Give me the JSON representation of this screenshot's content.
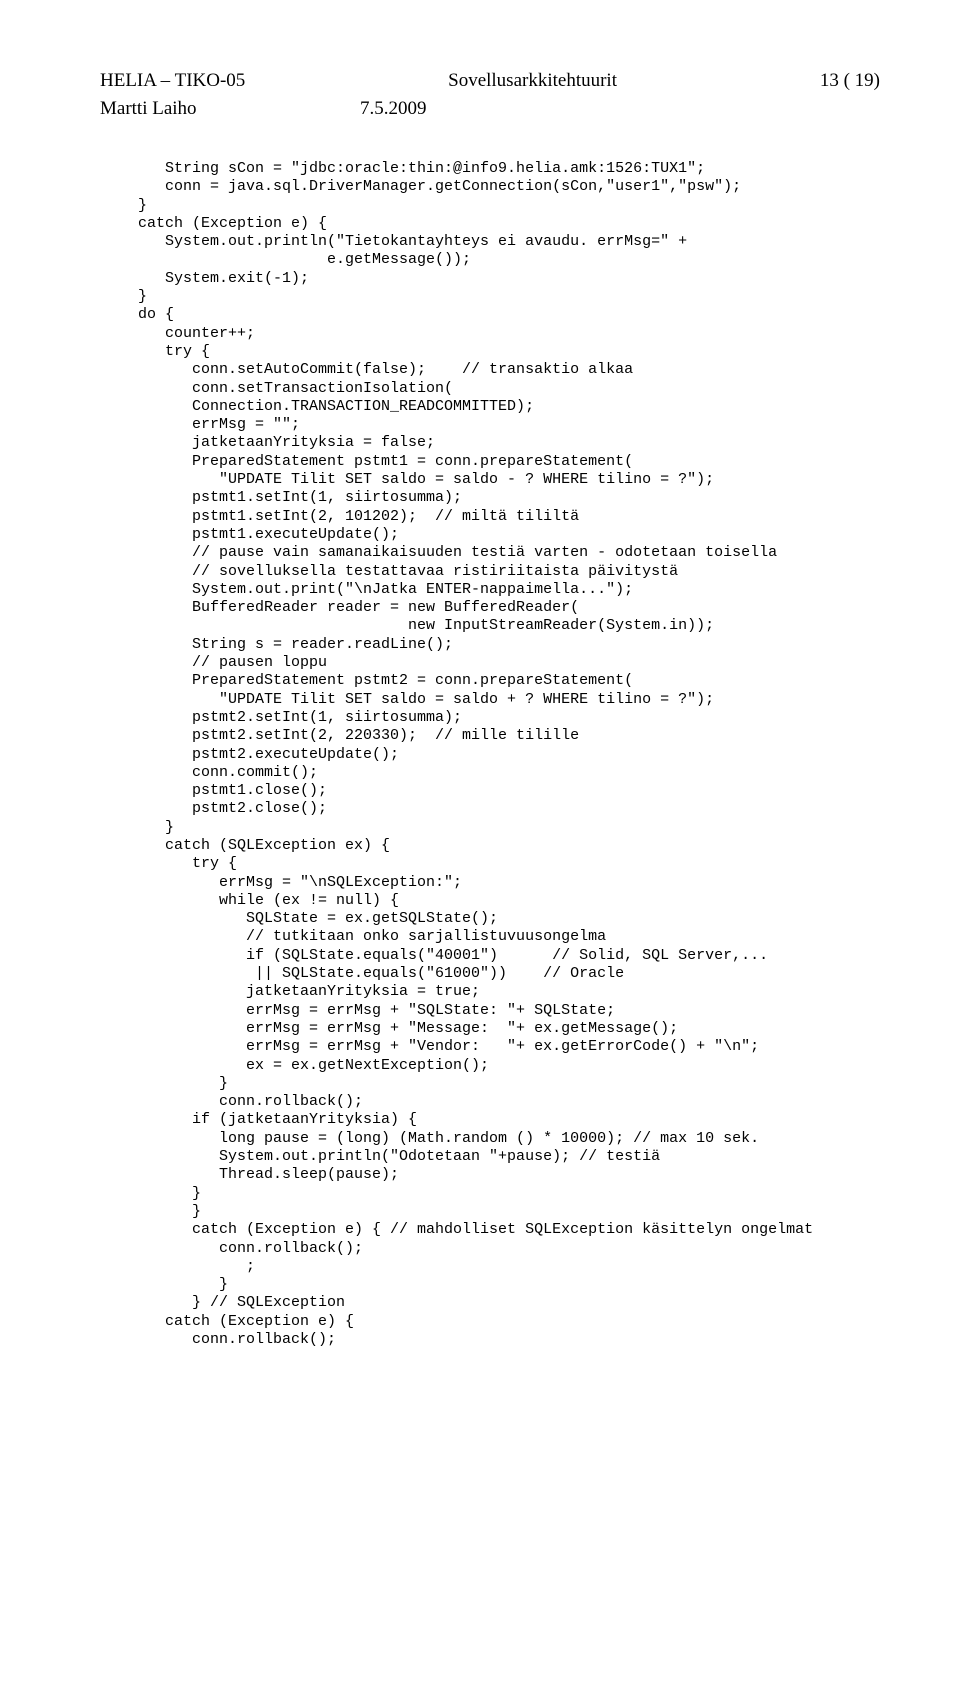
{
  "header": {
    "left": "HELIA – TIKO-05",
    "center": "Sovellusarkkitehtuurit",
    "right": "13 ( 19)"
  },
  "subheader": {
    "author": "Martti Laiho",
    "date": "7.5.2009"
  },
  "code": "   String sCon = \"jdbc:oracle:thin:@info9.helia.amk:1526:TUX1\";\n   conn = java.sql.DriverManager.getConnection(sCon,\"user1\",\"psw\");\n}\ncatch (Exception e) {\n   System.out.println(\"Tietokantayhteys ei avaudu. errMsg=\" +\n                     e.getMessage());\n   System.exit(-1);\n}\ndo {\n   counter++;\n   try {\n      conn.setAutoCommit(false);    // transaktio alkaa\n      conn.setTransactionIsolation(\n      Connection.TRANSACTION_READCOMMITTED);\n      errMsg = \"\";\n      jatketaanYrityksia = false;\n      PreparedStatement pstmt1 = conn.prepareStatement(\n         \"UPDATE Tilit SET saldo = saldo - ? WHERE tilino = ?\");\n      pstmt1.setInt(1, siirtosumma);\n      pstmt1.setInt(2, 101202);  // miltä tililtä\n      pstmt1.executeUpdate();\n      // pause vain samanaikaisuuden testiä varten - odotetaan toisella\n      // sovelluksella testattavaa ristiriitaista päivitystä\n      System.out.print(\"\\nJatka ENTER-nappaimella...\");\n      BufferedReader reader = new BufferedReader(\n                              new InputStreamReader(System.in));\n      String s = reader.readLine();\n      // pausen loppu\n      PreparedStatement pstmt2 = conn.prepareStatement(\n         \"UPDATE Tilit SET saldo = saldo + ? WHERE tilino = ?\");\n      pstmt2.setInt(1, siirtosumma);\n      pstmt2.setInt(2, 220330);  // mille tilille\n      pstmt2.executeUpdate();\n      conn.commit();\n      pstmt1.close();\n      pstmt2.close();\n   }\n   catch (SQLException ex) {\n      try {\n         errMsg = \"\\nSQLException:\";\n         while (ex != null) {\n            SQLState = ex.getSQLState();\n            // tutkitaan onko sarjallistuvuusongelma\n            if (SQLState.equals(\"40001\")      // Solid, SQL Server,...\n             || SQLState.equals(\"61000\"))    // Oracle\n            jatketaanYrityksia = true;\n            errMsg = errMsg + \"SQLState: \"+ SQLState;\n            errMsg = errMsg + \"Message:  \"+ ex.getMessage();\n            errMsg = errMsg + \"Vendor:   \"+ ex.getErrorCode() + \"\\n\";\n            ex = ex.getNextException();\n         }\n         conn.rollback();\n      if (jatketaanYrityksia) {\n         long pause = (long) (Math.random () * 10000); // max 10 sek.\n         System.out.println(\"Odotetaan \"+pause); // testiä\n         Thread.sleep(pause);\n      }\n      }\n      catch (Exception e) { // mahdolliset SQLException käsittelyn ongelmat\n         conn.rollback();\n            ;\n         }\n      } // SQLException\n   catch (Exception e) {\n      conn.rollback();"
}
